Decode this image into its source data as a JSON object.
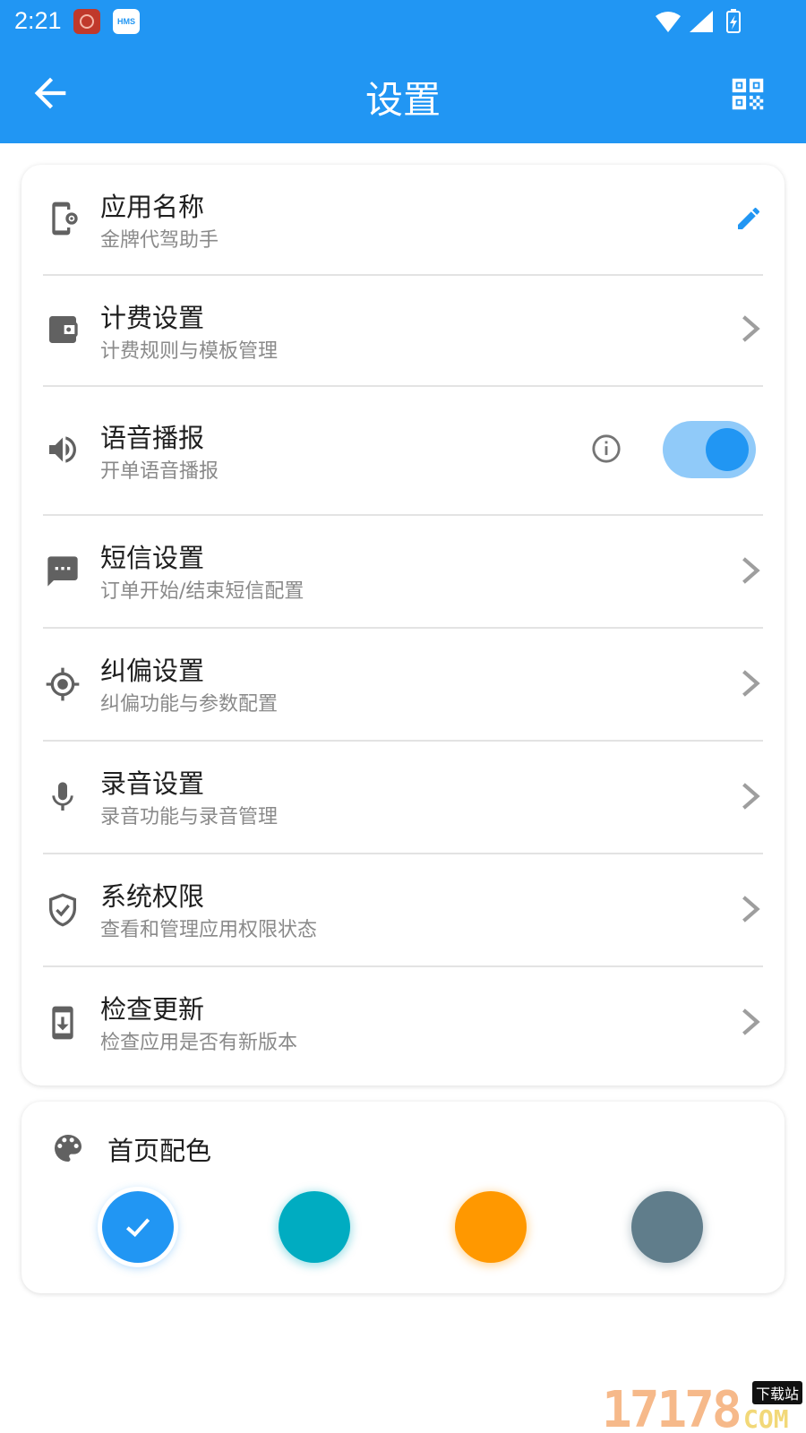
{
  "status_bar": {
    "time": "2:21",
    "hms_badge": "HMS"
  },
  "app_bar": {
    "title": "设置"
  },
  "settings": [
    {
      "title": "应用名称",
      "subtitle": "金牌代驾助手",
      "icon": "app-settings-icon",
      "trailing": "edit-icon"
    },
    {
      "title": "计费设置",
      "subtitle": "计费规则与模板管理",
      "icon": "wallet-icon",
      "trailing": "chevron-right-icon"
    },
    {
      "title": "语音播报",
      "subtitle": "开单语音播报",
      "icon": "volume-icon",
      "trailing": "toggle",
      "toggle_on": true
    },
    {
      "title": "短信设置",
      "subtitle": "订单开始/结束短信配置",
      "icon": "sms-icon",
      "trailing": "chevron-right-icon"
    },
    {
      "title": "纠偏设置",
      "subtitle": "纠偏功能与参数配置",
      "icon": "gps-fixed-icon",
      "trailing": "chevron-right-icon"
    },
    {
      "title": "录音设置",
      "subtitle": "录音功能与录音管理",
      "icon": "mic-icon",
      "trailing": "chevron-right-icon"
    },
    {
      "title": "系统权限",
      "subtitle": "查看和管理应用权限状态",
      "icon": "shield-check-icon",
      "trailing": "chevron-right-icon"
    },
    {
      "title": "检查更新",
      "subtitle": "检查应用是否有新版本",
      "icon": "system-update-icon",
      "trailing": "chevron-right-icon"
    }
  ],
  "theme": {
    "title": "首页配色",
    "colors": [
      "#2196f3",
      "#00acc1",
      "#ff9800",
      "#607d8b"
    ],
    "selected_index": 0
  },
  "accent_color": "#2196f3",
  "watermark": {
    "number": "17178",
    "tag": "下载站",
    "suffix": "COM"
  }
}
